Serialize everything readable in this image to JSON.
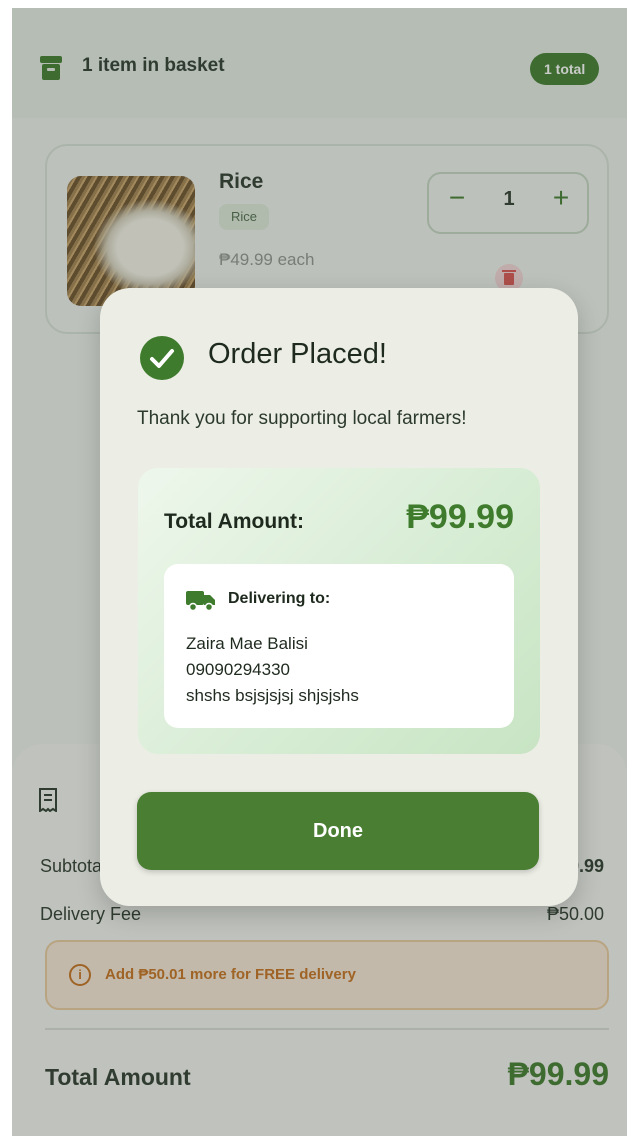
{
  "header": {
    "title": "1 item in basket",
    "badge": "1 total",
    "icon": "basket-icon"
  },
  "item": {
    "name": "Rice",
    "category": "Rice",
    "price": "₱49.99 each",
    "quantity": "1",
    "minus_label": "−",
    "plus_label": "+"
  },
  "summary": {
    "subtotal_label": "Subtotal",
    "subtotal_value": "₱49.99",
    "delivery_label": "Delivery Fee",
    "delivery_value": "₱50.00",
    "free_delivery_note": "Add ₱50.01 more for FREE delivery",
    "total_label": "Total Amount",
    "total_value": "₱99.99"
  },
  "dialog": {
    "title": "Order Placed!",
    "subtitle": "Thank you for supporting local farmers!",
    "amount_label": "Total Amount:",
    "amount_value": "₱99.99",
    "delivery_heading": "Delivering to:",
    "recipient_name": "Zaira Mae Balisi",
    "recipient_phone": "09090294330",
    "recipient_address": "shshs bsjsjsjsj shjsjshs",
    "done_label": "Done"
  },
  "colors": {
    "primary_green": "#3e7b2c",
    "button_green": "#4a7f33",
    "warning_orange": "#c5701c",
    "delete_red": "#d9534f"
  }
}
